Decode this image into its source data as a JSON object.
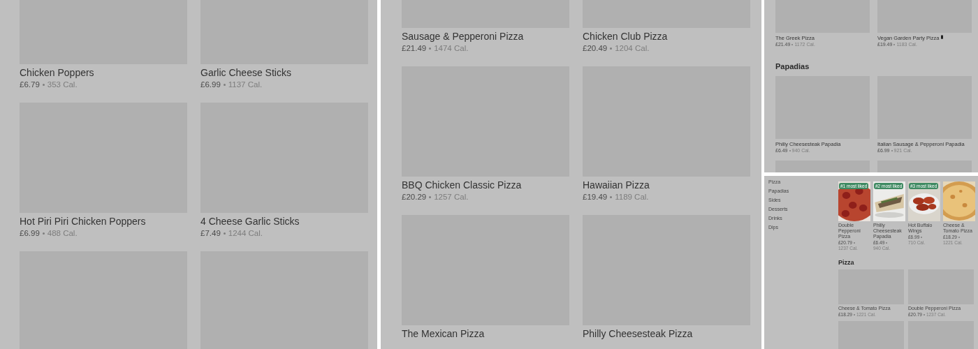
{
  "panels": [
    {
      "sections": [
        {
          "items": [
            {
              "kind": "card",
              "name": "Chicken Poppers",
              "price": "£6.79",
              "calories": "353 Cal."
            },
            {
              "kind": "card",
              "name": "Garlic Cheese Sticks",
              "price": "£6.99",
              "calories": "1137 Cal."
            },
            {
              "kind": "card",
              "name": "Hot Piri Piri Chicken Poppers",
              "price": "£6.99",
              "calories": "488 Cal."
            },
            {
              "kind": "card",
              "name": "4 Cheese Garlic Sticks",
              "price": "£7.49",
              "calories": "1244 Cal."
            },
            {
              "kind": "image_only"
            },
            {
              "kind": "image_only"
            }
          ]
        }
      ]
    },
    {
      "sections": [
        {
          "items": [
            {
              "kind": "card",
              "name": "Sausage & Pepperoni Pizza",
              "price": "£21.49",
              "calories": "1474 Cal."
            },
            {
              "kind": "card",
              "name": "Chicken Club Pizza",
              "price": "£20.49",
              "calories": "1204 Cal."
            },
            {
              "kind": "card",
              "name": "BBQ Chicken Classic Pizza",
              "price": "£20.29",
              "calories": "1257 Cal."
            },
            {
              "kind": "card",
              "name": "Hawaiian Pizza",
              "price": "£19.49",
              "calories": "1189 Cal."
            },
            {
              "kind": "card",
              "name": "The Mexican Pizza"
            },
            {
              "kind": "card",
              "name": "Philly Cheesesteak Pizza"
            }
          ]
        }
      ]
    },
    {
      "sections": [
        {
          "items": [
            {
              "kind": "card",
              "name": "The Greek Pizza",
              "price": "£21.49",
              "calories": "1172 Cal."
            },
            {
              "kind": "card",
              "name": "Vegan Garden Party Pizza",
              "price": "£19.49",
              "calories": "1183 Cal.",
              "vegan": true
            }
          ]
        },
        {
          "title": "Papadias",
          "items": [
            {
              "kind": "card",
              "name": "Philly Cheesesteak Papadia",
              "price": "£6.49",
              "calories": "940 Cal."
            },
            {
              "kind": "card",
              "name": "Italian Sausage & Pepperoni Papadia",
              "price": "£6.99",
              "calories": "921 Cal."
            },
            {
              "kind": "image_only"
            },
            {
              "kind": "image_only"
            }
          ]
        }
      ]
    },
    {
      "nav": [
        "Pizza",
        "Papadias",
        "Sides",
        "Desserts",
        "Drinks",
        "Dips"
      ],
      "featured": [
        {
          "badge": "#1 most liked",
          "name": "Double Pepperoni Pizza",
          "price": "£20.79",
          "calories": "1237 Cal."
        },
        {
          "badge": "#2 most liked",
          "name": "Philly Cheesesteak Papadia",
          "price": "£6.49",
          "calories": "940 Cal."
        },
        {
          "badge": "#3 most liked",
          "name": "Hot Buffalo Wings",
          "price": "£6.99",
          "calories": "710 Cal."
        },
        {
          "name": "Cheese & Tomato Pizza",
          "price": "£18.29",
          "calories": "1221 Cal."
        }
      ],
      "sections": [
        {
          "title": "Pizza",
          "items": [
            {
              "kind": "card",
              "name": "Cheese & Tomato Pizza",
              "price": "£18.29",
              "calories": "1221 Cal."
            },
            {
              "kind": "card",
              "name": "Double Pepperoni Pizza",
              "price": "£20.79",
              "calories": "1237 Cal."
            },
            {
              "kind": "image_only"
            },
            {
              "kind": "image_only"
            }
          ]
        }
      ]
    }
  ]
}
